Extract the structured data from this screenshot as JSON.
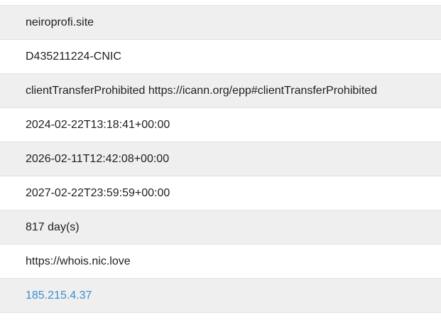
{
  "whois": {
    "rows": [
      {
        "value": "neiroprofi.site"
      },
      {
        "value": "D435211224-CNIC"
      },
      {
        "value": "clientTransferProhibited https://icann.org/epp#clientTransferProhibited"
      },
      {
        "value": "2024-02-22T13:18:41+00:00"
      },
      {
        "value": "2026-02-11T12:42:08+00:00"
      },
      {
        "value": "2027-02-22T23:59:59+00:00"
      },
      {
        "value": "817 day(s)"
      },
      {
        "value": "https://whois.nic.love"
      },
      {
        "value": "185.215.4.37"
      }
    ],
    "link_color": "#3b8ed0",
    "alt_row_color": "#efefef"
  }
}
